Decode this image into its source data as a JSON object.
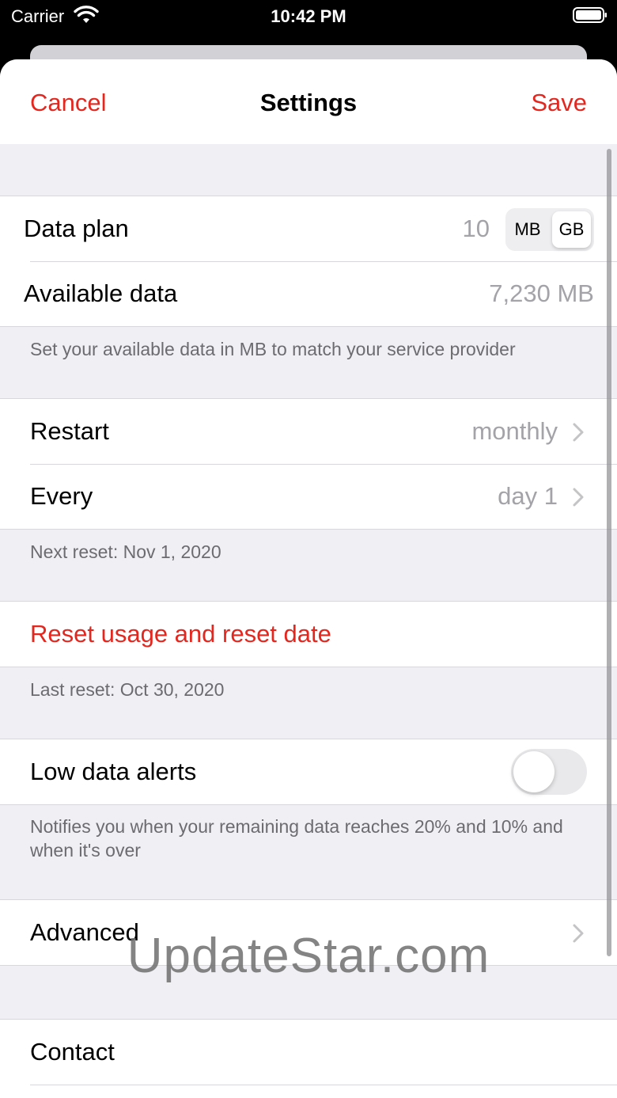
{
  "status_bar": {
    "carrier": "Carrier",
    "time": "10:42 PM",
    "wifi_icon": "wifi-icon",
    "battery_icon": "battery-icon"
  },
  "nav": {
    "cancel": "Cancel",
    "title": "Settings",
    "save": "Save"
  },
  "data_plan": {
    "label": "Data plan",
    "value": "10",
    "units": [
      "MB",
      "GB"
    ],
    "selected_unit": "GB"
  },
  "available_data": {
    "label": "Available data",
    "value": "7,230 MB"
  },
  "available_footer": "Set your available data in MB to match your service provider",
  "restart": {
    "label": "Restart",
    "value": "monthly"
  },
  "every": {
    "label": "Every",
    "value": "day 1"
  },
  "next_reset_footer": "Next reset: Nov 1, 2020",
  "reset_action": "Reset usage and reset date",
  "last_reset_footer": "Last reset: Oct 30, 2020",
  "low_data_alerts": {
    "label": "Low data alerts",
    "enabled": false
  },
  "alerts_footer": "Notifies you when your remaining data reaches 20% and 10% and when it's over",
  "advanced": {
    "label": "Advanced"
  },
  "contact": {
    "label": "Contact"
  },
  "watermark": "UpdateStar.com",
  "colors": {
    "accent": "#e3271f",
    "secondary_text": "#a3a3a8",
    "grouped_background": "#f0eff4"
  }
}
